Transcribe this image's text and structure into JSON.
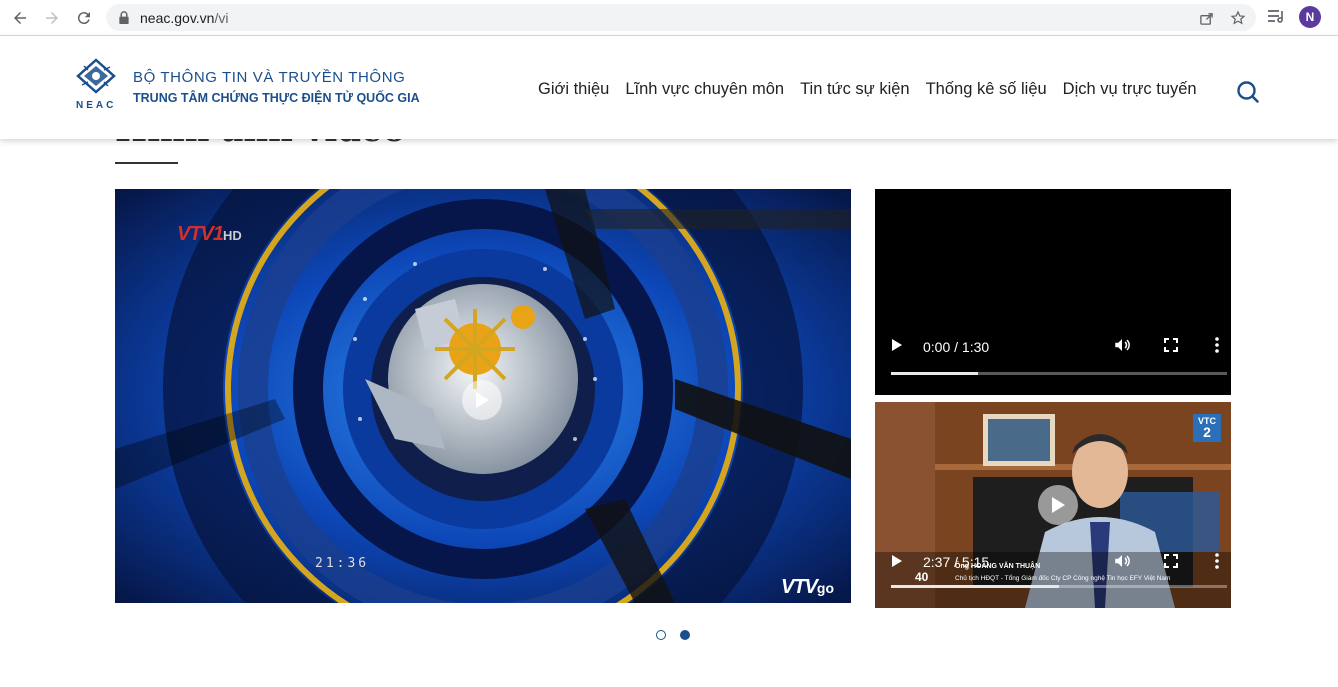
{
  "browser": {
    "url_host": "neac.gov.vn",
    "url_path": "/vi",
    "profile_initial": "N"
  },
  "header": {
    "logo_text": "NEAC",
    "org_line1": "BỘ THÔNG TIN VÀ TRUYỀN THÔNG",
    "org_line2": "TRUNG TÂM CHỨNG THỰC ĐIỆN TỬ QUỐC GIA",
    "menu": [
      {
        "label": "Giới thiệu"
      },
      {
        "label": "Lĩnh vực chuyên môn"
      },
      {
        "label": "Tin tức sự kiện"
      },
      {
        "label": "Thống kê số liệu"
      },
      {
        "label": "Dịch vụ trực tuyến"
      }
    ],
    "search_icon": "search-icon"
  },
  "section": {
    "title": "Hình ảnh video"
  },
  "main_video": {
    "channel_logo": "VTV1",
    "channel_hd": "HD",
    "clock": "21:36",
    "watermark": "VTVgo",
    "watermark_go": "go"
  },
  "side_videos": [
    {
      "time": "0:00 / 1:30",
      "progress_fraction": 0.26
    },
    {
      "time": "2:37 / 5:15",
      "progress_fraction": 0.5,
      "channel_badge": "VTC",
      "channel_badge_num": "2",
      "caption_name": "Ông HOÀNG VĂN THUẬN",
      "caption_title": "Chủ tịch HĐQT - Tổng Giám đốc Cty CP Công nghệ Tin học EFY Việt Nam",
      "year_badge": "40"
    }
  ],
  "carousel": {
    "pages": 2,
    "active": 1
  },
  "colors": {
    "brand": "#1b4f8c"
  }
}
